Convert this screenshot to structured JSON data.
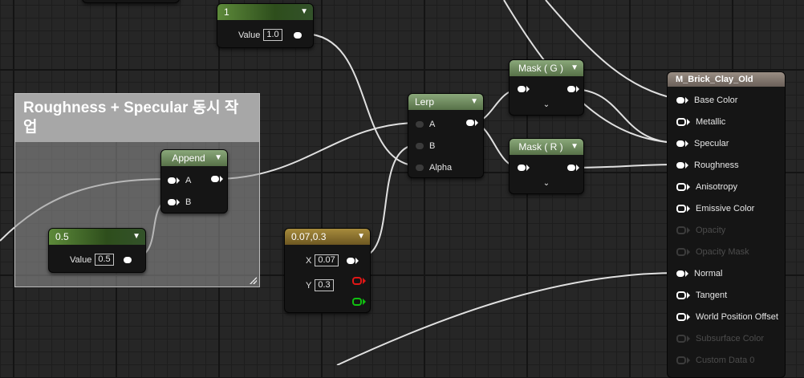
{
  "comment": {
    "title": "Roughness + Specular 동시 작업"
  },
  "nodes": {
    "const_1": {
      "header": "1",
      "value_label": "Value",
      "value": "1.0"
    },
    "const_05": {
      "header": "0.5",
      "value_label": "Value",
      "value": "0.5"
    },
    "append": {
      "header": "Append",
      "pin_a": "A",
      "pin_b": "B"
    },
    "lerp": {
      "header": "Lerp",
      "pin_a": "A",
      "pin_b": "B",
      "pin_alpha": "Alpha"
    },
    "mask_g": {
      "header": "Mask ( G )"
    },
    "mask_r": {
      "header": "Mask ( R )"
    },
    "const2": {
      "header": "0.07,0.3",
      "x_label": "X",
      "x_value": "0.07",
      "y_label": "Y",
      "y_value": "0.3"
    }
  },
  "material": {
    "name": "M_Brick_Clay_Old",
    "inputs": [
      {
        "label": "Base Color",
        "active": true,
        "connected": true
      },
      {
        "label": "Metallic",
        "active": true,
        "connected": false
      },
      {
        "label": "Specular",
        "active": true,
        "connected": true
      },
      {
        "label": "Roughness",
        "active": true,
        "connected": true
      },
      {
        "label": "Anisotropy",
        "active": true,
        "connected": false
      },
      {
        "label": "Emissive Color",
        "active": true,
        "connected": false
      },
      {
        "label": "Opacity",
        "active": false,
        "connected": false
      },
      {
        "label": "Opacity Mask",
        "active": false,
        "connected": false
      },
      {
        "label": "Normal",
        "active": true,
        "connected": true
      },
      {
        "label": "Tangent",
        "active": true,
        "connected": false
      },
      {
        "label": "World Position Offset",
        "active": true,
        "connected": false
      },
      {
        "label": "Subsurface Color",
        "active": false,
        "connected": false
      },
      {
        "label": "Custom Data 0",
        "active": false,
        "connected": false
      }
    ]
  },
  "colors": {
    "wire": "#e8e8e8",
    "graph_bg": "#262626",
    "material_header": "#8a7e74",
    "lerp_header": "#6f8f5f",
    "vector2_header": "#8c7430"
  },
  "icons": {
    "chevron": "chevron-down-icon",
    "resize": "resize-handle-icon"
  }
}
